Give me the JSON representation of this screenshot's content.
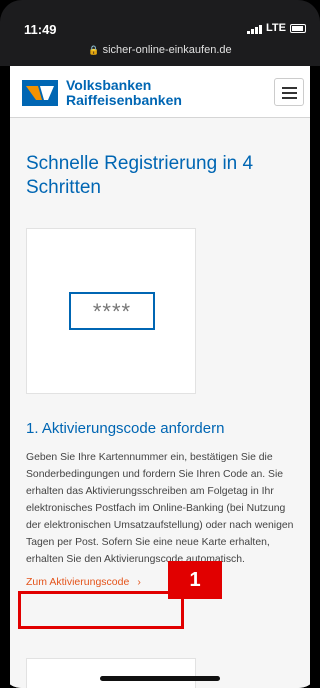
{
  "status_bar": {
    "time": "11:49",
    "network": "LTE",
    "url": "sicher-online-einkaufen.de"
  },
  "header": {
    "brand_line1": "Volksbanken",
    "brand_line2": "Raiffeisenbanken"
  },
  "main": {
    "title": "Schnelle Registrierung in 4 Schritten",
    "code_placeholder": "****",
    "step_heading": "1. Aktivierungscode anfordern",
    "step_text": "Geben Sie Ihre Kartennummer ein, bestätigen Sie die Sonderbedingungen und fordern Sie Ihren Code an. Sie erhalten das Aktivierungsschreiben am Folgetag in Ihr elektronisches Postfach im Online-Banking (bei Nutzung der elektronischen Umsatzaufstellung) oder nach wenigen Tagen per Post. Sofern Sie eine neue Karte erhalten, erhalten Sie den Aktivierungscode automatisch.",
    "cta_label": "Zum Aktivierungscode",
    "cta_chevron": "›"
  },
  "annotation": {
    "marker_label": "1",
    "color": "#e10000"
  },
  "colors": {
    "brand_blue": "#0066b3",
    "brand_orange": "#f39200",
    "link_orange": "#e4541b"
  }
}
